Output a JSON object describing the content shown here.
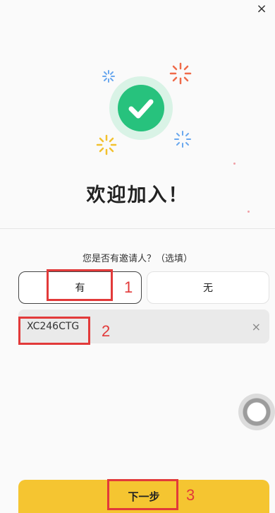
{
  "header": {
    "close_icon": "close-icon",
    "close_symbol": "×"
  },
  "hero": {
    "success_icon": "checkmark-icon",
    "accent_color": "#27c27d"
  },
  "welcome_title": "欢迎加入！",
  "inviter": {
    "question": "您是否有邀请人？（选填）",
    "options": [
      {
        "label": "有",
        "selected": true
      },
      {
        "label": "无",
        "selected": false
      }
    ],
    "code_value": "XC246CTG",
    "clear_symbol": "×"
  },
  "next_button": {
    "label": "下一步",
    "color": "#f5c531"
  },
  "annotations": [
    "1",
    "2",
    "3"
  ]
}
